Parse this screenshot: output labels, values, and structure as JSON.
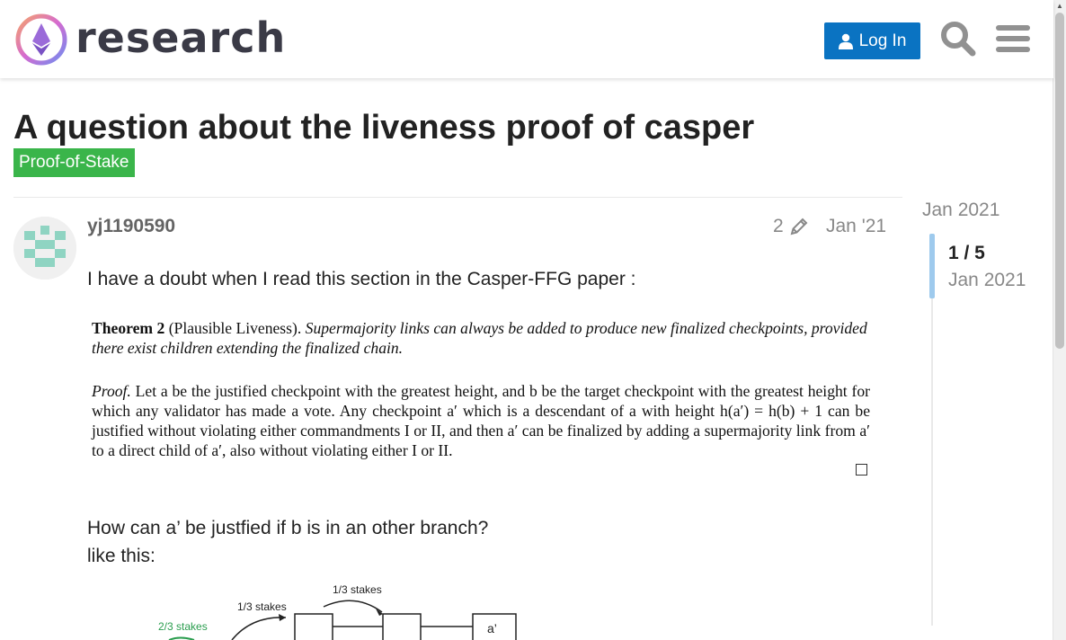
{
  "header": {
    "site_name": "research",
    "login_label": "Log In",
    "icons": [
      "logo-icon",
      "user-icon",
      "search-icon",
      "hamburger-menu-icon"
    ]
  },
  "topic": {
    "title": "A question about the liveness proof of casper",
    "category": "Proof-of-Stake"
  },
  "post": {
    "username": "yj1190590",
    "edit_count": "2",
    "date": "Jan '21",
    "intro": "I have a doubt when I read this section in the Casper-FFG paper :",
    "question": "How can a’ be justfied if b is in an other branch?",
    "like_this": "like this:"
  },
  "paper_excerpt": {
    "theorem_label": "Theorem 2",
    "theorem_name": "(Plausible Liveness).",
    "theorem_text": "Supermajority links can always be added to produce new finalized checkpoints, provided there exist children extending the finalized chain.",
    "proof_label": "Proof.",
    "proof_text": "Let a be the justified checkpoint with the greatest height, and b be the target checkpoint with the greatest height for which any validator has made a vote. Any checkpoint a′ which is a descendant of a with height h(a′) = h(b) + 1 can be justified without violating either commandments I or II, and then a′ can be finalized by adding a supermajority link from a′ to a direct child of a′, also without violating either I or II."
  },
  "diagram": {
    "label_left": "2/3 stakes",
    "label_mid": "1/3 stakes",
    "label_top": "1/3 stakes",
    "node_label": "a’"
  },
  "timeline": {
    "top_date": "Jan 2021",
    "position": "1 / 5",
    "position_date": "Jan 2021"
  },
  "colors": {
    "login_button": "#0a73c2",
    "category_badge": "#3ab54a",
    "timeline_handle": "#9ecaed"
  }
}
